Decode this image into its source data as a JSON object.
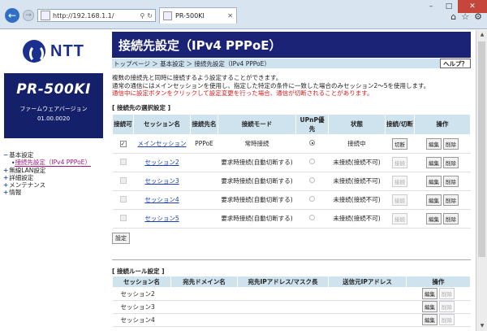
{
  "browser": {
    "url": "http://192.168.1.1/",
    "tab_title": "PR-500KI"
  },
  "sidebar": {
    "logo_text": "NTT",
    "model": "PR-500KI",
    "firmware_label": "ファームウェアバージョン",
    "firmware_version": "01.00.0020",
    "nav": {
      "basic": "基本設定",
      "basic_sub": "接続先設定（IPv4 PPPoE）",
      "wireless": "無線LAN設定",
      "detail": "詳細設定",
      "maint": "メンテナンス",
      "info": "情報"
    }
  },
  "main": {
    "title": "接続先設定（IPv4 PPPoE）",
    "breadcrumb": "トップページ ＞ 基本設定 ＞ 接続先設定（IPv4 PPPoE）",
    "help": "ヘルプ？",
    "desc1": "複数の接続先と同時に接続するよう設定することができます。",
    "desc2": "通常の通信にはメインセッションを使用し、指定した特定の条件に一致した場合のみセッション2～5を使用します。",
    "desc_warn": "通信中に設定ボタンをクリックして設定変更を行った場合、通信が切断されることがあります。",
    "select_section": "[ 接続先の選択設定 ]",
    "rule_section": "[ 接続ルール設定 ]",
    "set_button": "設定"
  },
  "t1": {
    "headers": [
      "接続可",
      "セッション名",
      "接続先名",
      "接続モード",
      "UPnP優先",
      "状態",
      "接続/切断",
      "操作"
    ],
    "rows": [
      {
        "name": "メインセッション",
        "dest": "PPPoE",
        "mode": "常時接続",
        "status": "接続中",
        "conn": "切断",
        "checked": true
      },
      {
        "name": "セッション2",
        "dest": "",
        "mode": "要求時接続(自動切断する)",
        "status": "未接続(接続不可)",
        "conn": "接続",
        "checked": false
      },
      {
        "name": "セッション3",
        "dest": "",
        "mode": "要求時接続(自動切断する)",
        "status": "未接続(接続不可)",
        "conn": "接続",
        "checked": false
      },
      {
        "name": "セッション4",
        "dest": "",
        "mode": "要求時接続(自動切断する)",
        "status": "未接続(接続不可)",
        "conn": "接続",
        "checked": false
      },
      {
        "name": "セッション5",
        "dest": "",
        "mode": "要求時接続(自動切断する)",
        "status": "未接続(接続不可)",
        "conn": "接続",
        "checked": false
      }
    ],
    "edit": "編集",
    "delete": "削除"
  },
  "t2": {
    "headers": [
      "セッション名",
      "宛先ドメイン名",
      "宛先IPアドレス/マスク長",
      "送信元IPアドレス",
      "操作"
    ],
    "rows": [
      {
        "name": "セッション2"
      },
      {
        "name": "セッション3"
      },
      {
        "name": "セッション4"
      }
    ],
    "edit": "編集",
    "delete": "削除"
  },
  "colors": {
    "title_bg": "#1b2377",
    "header_bg": "#cfe3ef",
    "warn": "#d81818",
    "link": "#1a3fb8"
  }
}
